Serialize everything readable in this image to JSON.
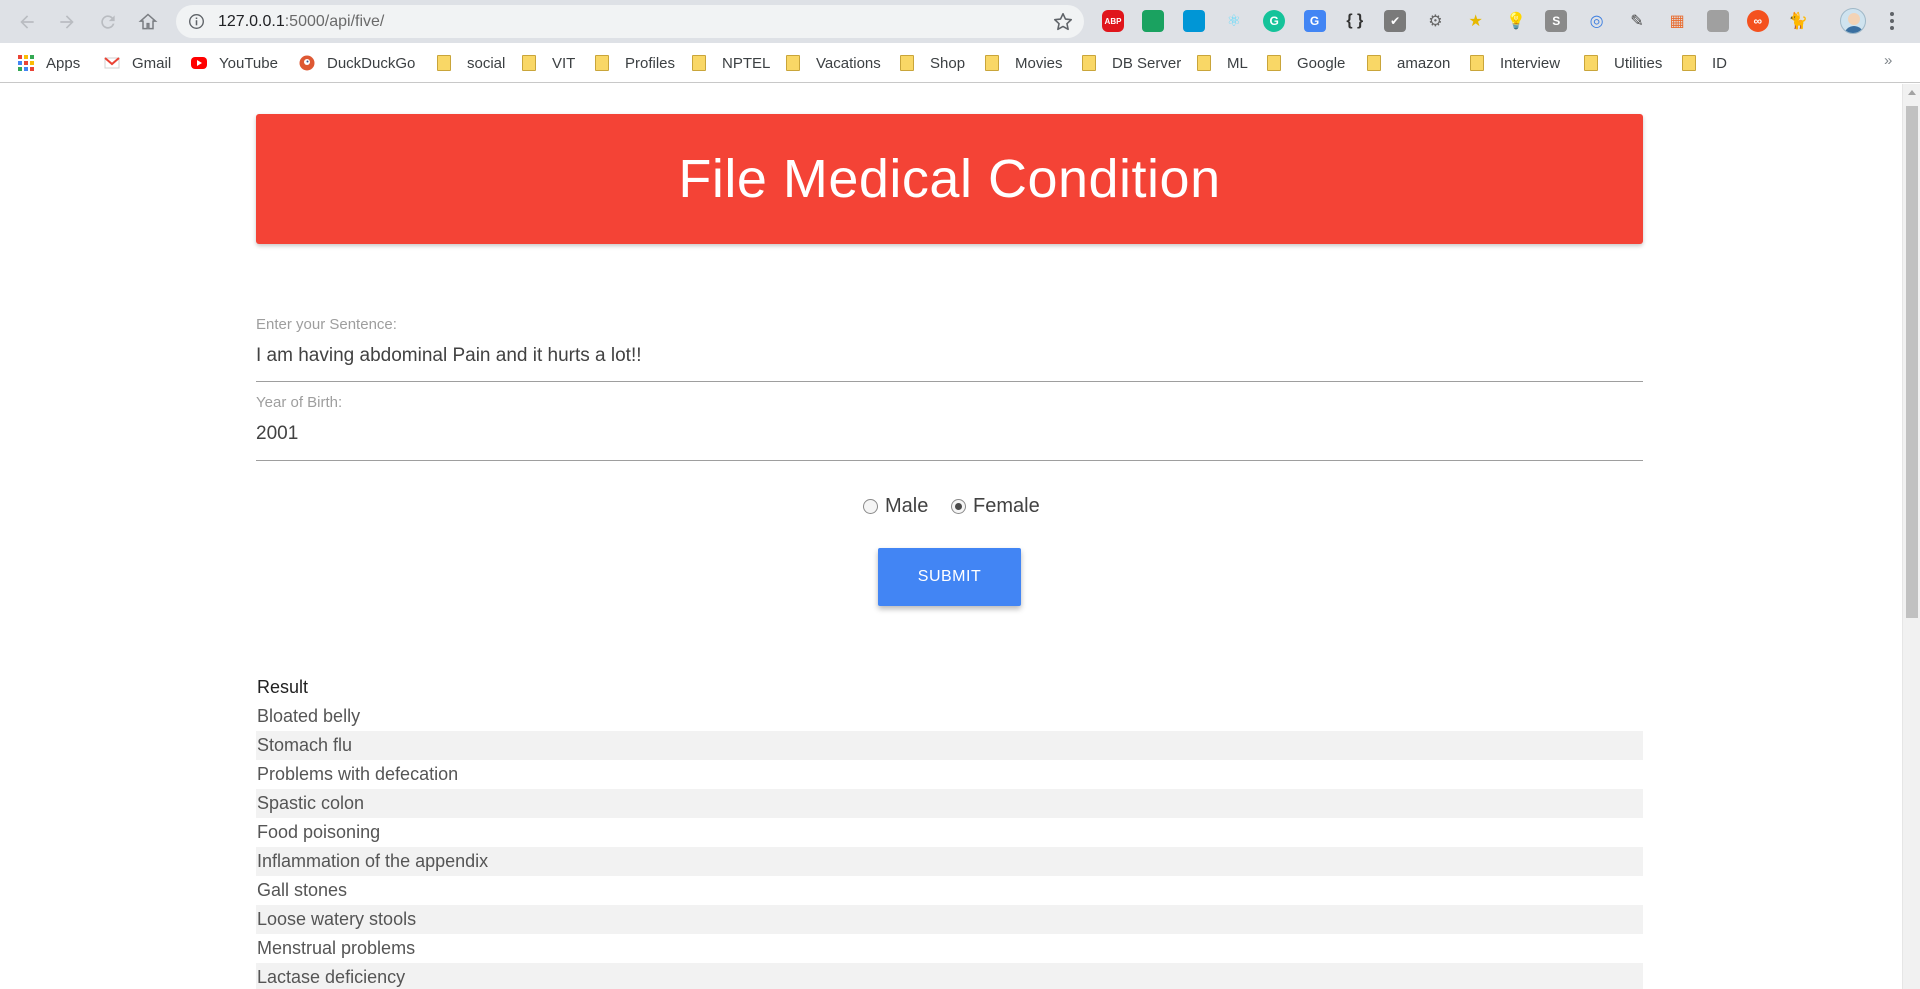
{
  "browser": {
    "url_host": "127.0.0.1",
    "url_rest": ":5000/api/five/",
    "extensions": [
      {
        "name": "adblock-plus-icon",
        "color": "#e0151b",
        "text": "ABP",
        "shape": "octagon"
      },
      {
        "name": "green-extension-icon",
        "color": "#1aa260",
        "text": "",
        "shape": "rounded"
      },
      {
        "name": "blue-window-icon",
        "color": "#0096d6",
        "text": "",
        "shape": "rounded"
      },
      {
        "name": "react-devtools-icon",
        "color": "#61dafb",
        "text": "⚛",
        "shape": "glyph"
      },
      {
        "name": "grammarly-icon",
        "color": "#15c39a",
        "text": "G",
        "shape": "circle"
      },
      {
        "name": "google-translate-icon",
        "color": "#4285f4",
        "text": "G",
        "shape": "rounded"
      },
      {
        "name": "json-formatter-icon",
        "color": "#333333",
        "text": "{ }",
        "shape": "glyph"
      },
      {
        "name": "checkmark-extension-icon",
        "color": "#7a7a7a",
        "text": "✔",
        "shape": "rounded"
      },
      {
        "name": "gear-extension-icon",
        "color": "#666666",
        "text": "⚙",
        "shape": "glyph"
      },
      {
        "name": "star-extension-icon",
        "color": "#e6b800",
        "text": "★",
        "shape": "glyph"
      },
      {
        "name": "lightbulb-icon",
        "color": "#777777",
        "text": "💡",
        "shape": "glyph"
      },
      {
        "name": "s-extension-icon",
        "color": "#8a8a8a",
        "text": "S",
        "shape": "rounded"
      },
      {
        "name": "edge-swirl-icon",
        "color": "#3b7de0",
        "text": "◎",
        "shape": "glyph"
      },
      {
        "name": "wand-extension-icon",
        "color": "#444444",
        "text": "✎",
        "shape": "glyph"
      },
      {
        "name": "chart-extension-icon",
        "color": "#e86b2e",
        "text": "▦",
        "shape": "glyph"
      },
      {
        "name": "grey-box-icon",
        "color": "#a0a0a0",
        "text": "",
        "shape": "rounded"
      },
      {
        "name": "infinity-extension-icon",
        "color": "#f4511e",
        "text": "∞",
        "shape": "circle"
      },
      {
        "name": "github-cat-icon",
        "color": "#222222",
        "text": "🐈",
        "shape": "glyph"
      }
    ]
  },
  "bookmarks": [
    {
      "label": "Apps",
      "type": "apps"
    },
    {
      "label": "Gmail",
      "type": "gmail"
    },
    {
      "label": "YouTube",
      "type": "youtube"
    },
    {
      "label": "DuckDuckGo",
      "type": "duckduckgo"
    },
    {
      "label": "social",
      "type": "folder"
    },
    {
      "label": "VIT",
      "type": "folder"
    },
    {
      "label": "Profiles",
      "type": "folder"
    },
    {
      "label": "NPTEL",
      "type": "folder"
    },
    {
      "label": "Vacations",
      "type": "folder"
    },
    {
      "label": "Shop",
      "type": "folder"
    },
    {
      "label": "Movies",
      "type": "folder"
    },
    {
      "label": "DB Server",
      "type": "folder"
    },
    {
      "label": "ML",
      "type": "folder"
    },
    {
      "label": "Google",
      "type": "folder"
    },
    {
      "label": "amazon",
      "type": "folder"
    },
    {
      "label": "Interview",
      "type": "folder"
    },
    {
      "label": "Utilities",
      "type": "folder"
    },
    {
      "label": "ID",
      "type": "folder"
    }
  ],
  "page": {
    "title": "File Medical Condition",
    "sentence_label": "Enter your Sentence:",
    "sentence_value": "I am having abdominal Pain and it hurts a lot!!",
    "yob_label": "Year of Birth:",
    "yob_value": "2001",
    "gender": {
      "male_label": "Male",
      "female_label": "Female",
      "selected": "Female"
    },
    "submit_label": "SUBMIT",
    "banner_color": "#f44336",
    "button_color": "#4285f4"
  },
  "results": {
    "header": "Result",
    "items": [
      "Bloated belly",
      "Stomach flu",
      "Problems with defecation",
      "Spastic colon",
      "Food poisoning",
      "Inflammation of the appendix",
      "Gall stones",
      "Loose watery stools",
      "Menstrual problems",
      "Lactase deficiency"
    ]
  }
}
